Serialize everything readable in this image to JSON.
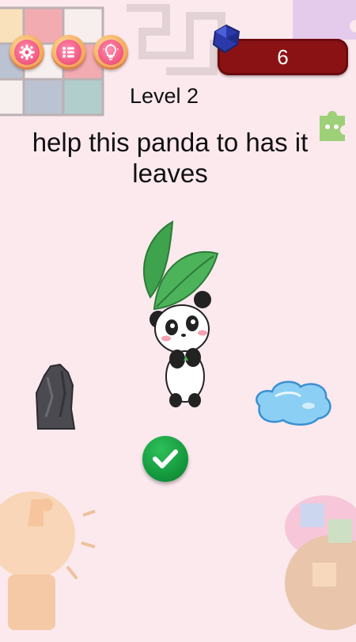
{
  "header": {
    "buttons": [
      {
        "name": "settings",
        "icon": "gear-icon"
      },
      {
        "name": "menu",
        "icon": "list-icon"
      },
      {
        "name": "hint",
        "icon": "lightbulb-icon"
      }
    ],
    "score": "6",
    "score_icon": "gem-icon"
  },
  "level": {
    "label": "Level 2"
  },
  "question": {
    "text": "help this panda to has it leaves"
  },
  "items": [
    {
      "name": "panda-with-leaf",
      "icon": "panda-icon"
    },
    {
      "name": "rock",
      "icon": "rock-icon"
    },
    {
      "name": "water-puddle",
      "icon": "water-icon"
    }
  ],
  "confirm": {
    "icon": "checkmark-icon"
  },
  "colors": {
    "background": "#fbe9ee",
    "score_bg": "#8b1214",
    "confirm_green": "#159a3e",
    "button_pink": "#f0557f"
  }
}
